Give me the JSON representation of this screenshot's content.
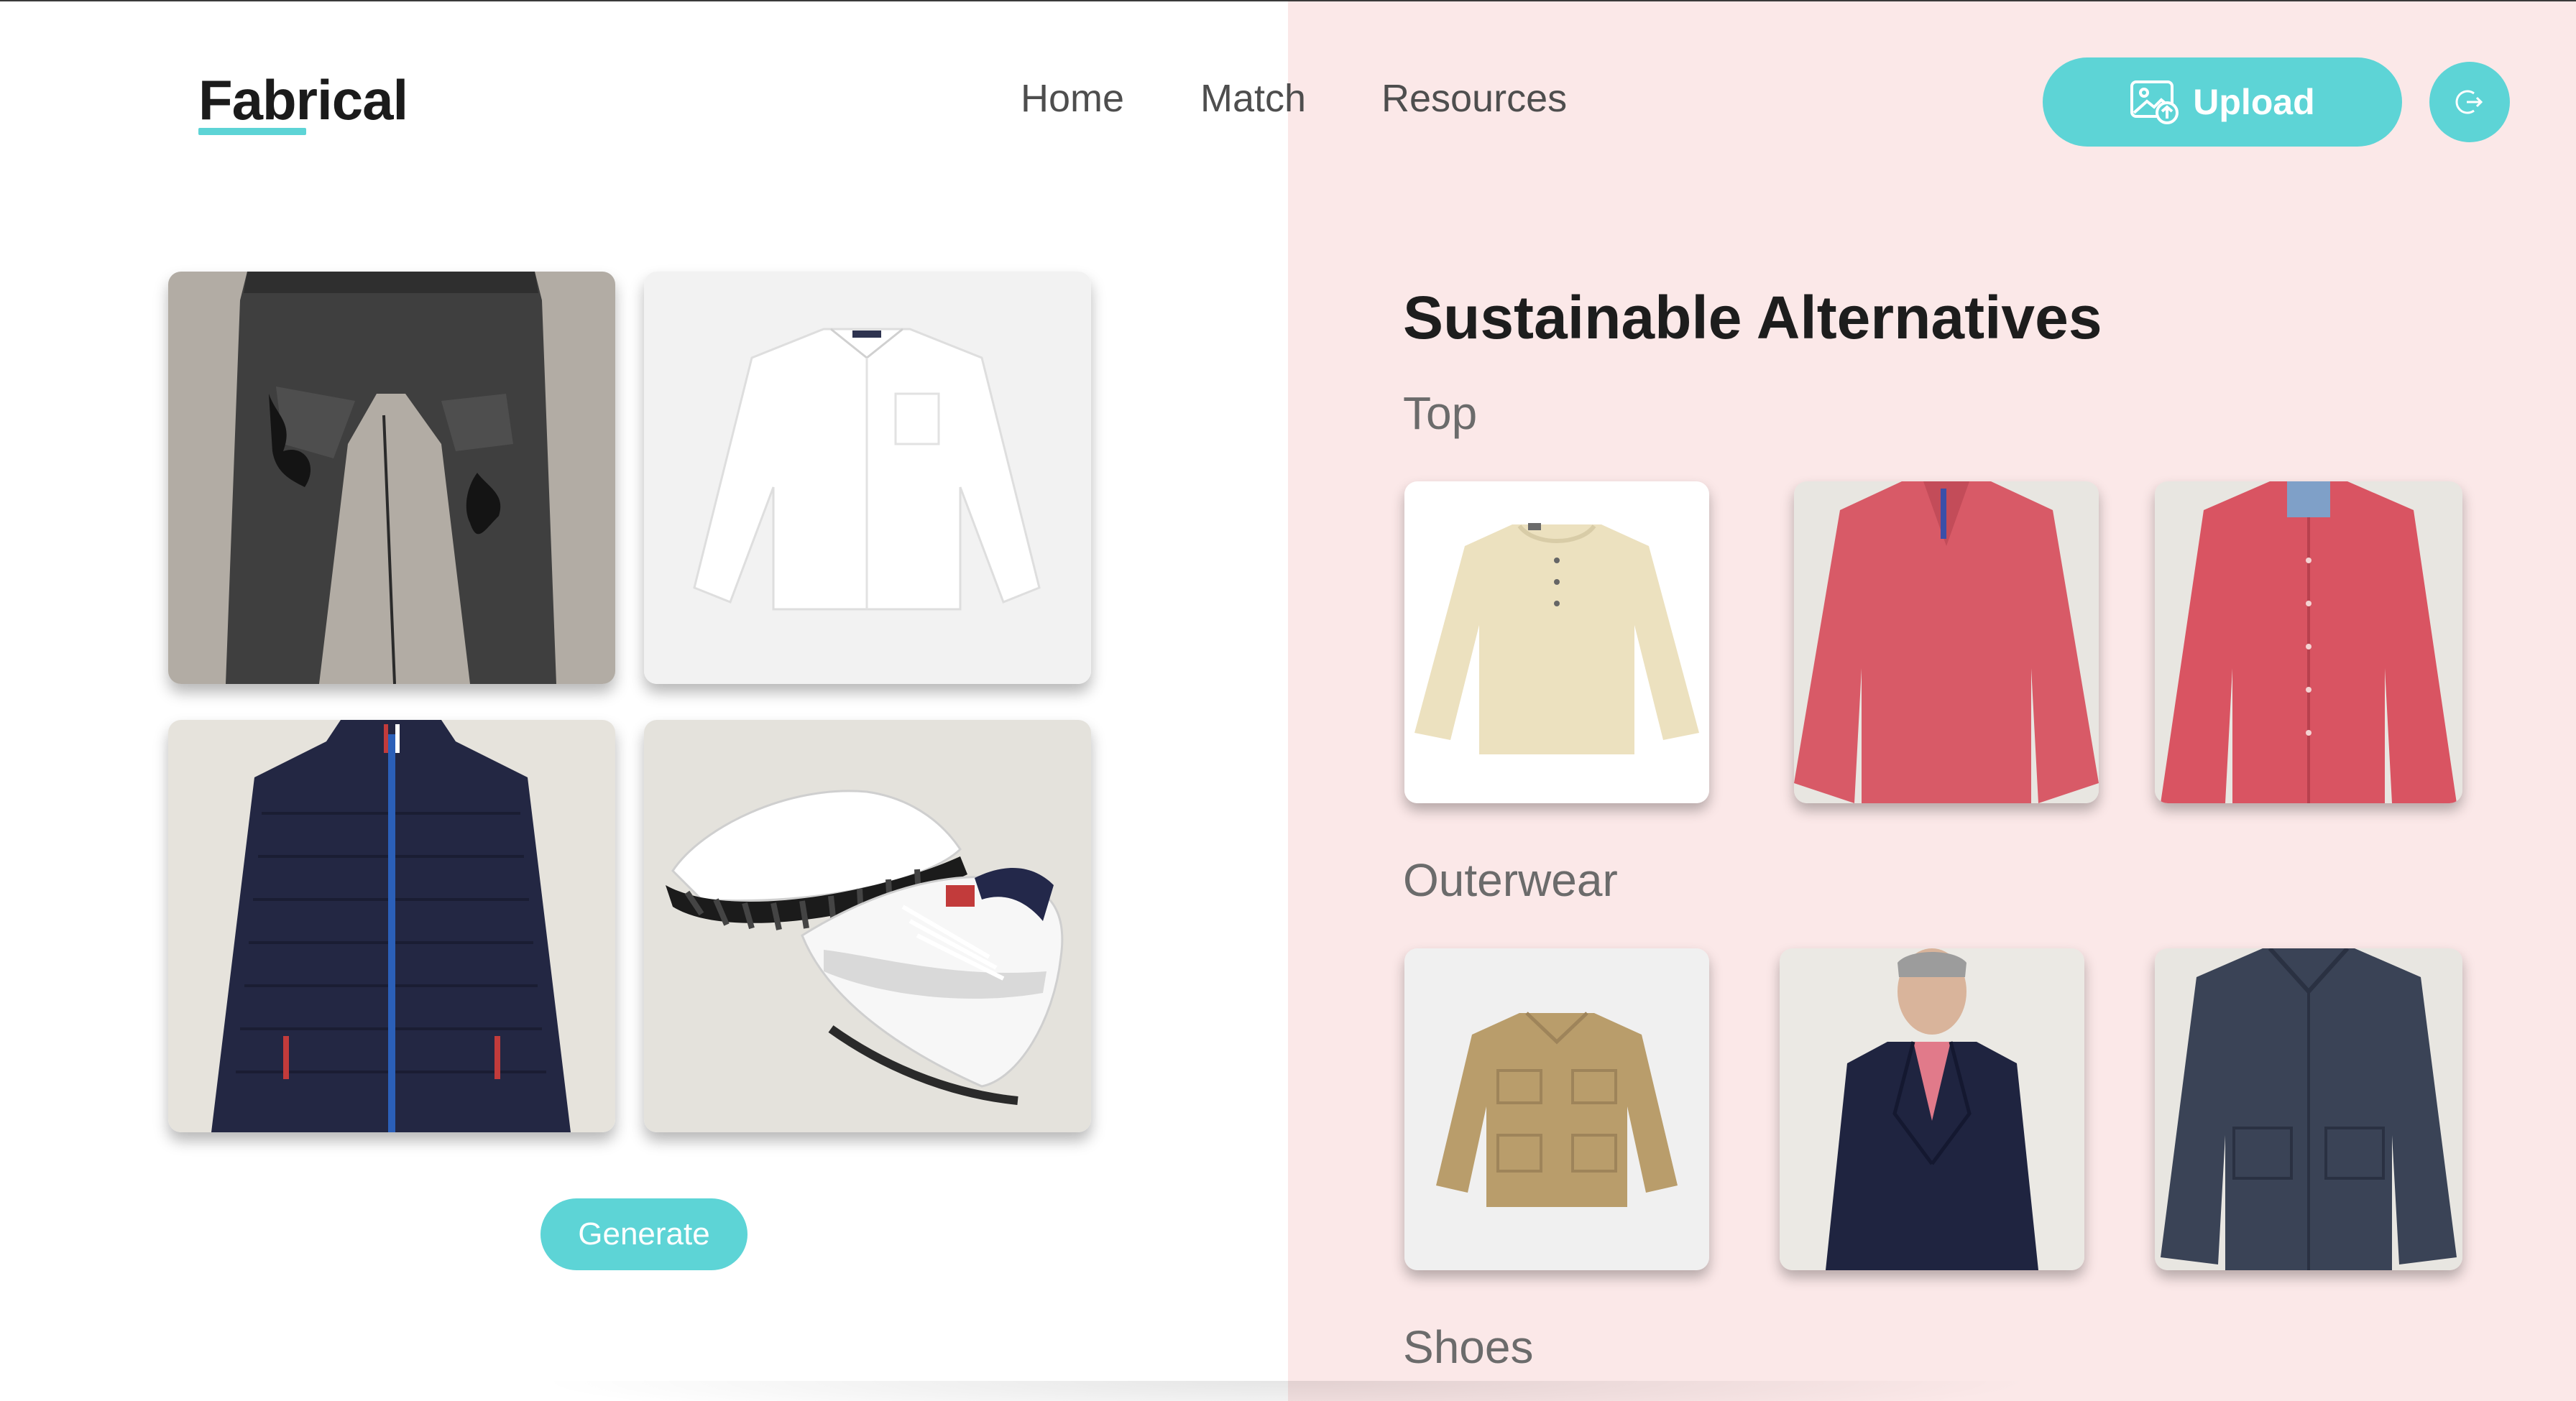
{
  "header": {
    "logo": "Fabrical",
    "nav": [
      "Home",
      "Match",
      "Resources"
    ],
    "upload_label": "Upload"
  },
  "closet": {
    "items": [
      {
        "icon": "ripped-jeans-image"
      },
      {
        "icon": "white-shirt-image"
      },
      {
        "icon": "navy-puffer-jacket-image"
      },
      {
        "icon": "sneakers-image"
      }
    ],
    "generate_label": "Generate"
  },
  "alternatives": {
    "title": "Sustainable Alternatives",
    "categories": [
      "Top",
      "Outerwear",
      "Shoes"
    ]
  },
  "colors": {
    "accent": "#5dd4d6",
    "panel": "#fbe8e8"
  }
}
